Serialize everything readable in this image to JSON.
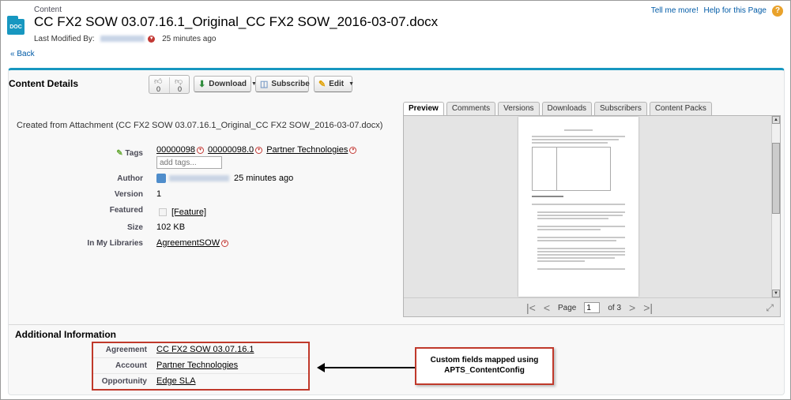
{
  "header": {
    "object_type": "Content",
    "icon_label": "DOC",
    "title": "CC FX2 SOW 03.07.16.1_Original_CC FX2 SOW_2016-03-07.docx",
    "modified_label": "Last Modified By:",
    "modified_time": "25 minutes ago",
    "back_link": "« Back"
  },
  "help": {
    "tell_me_more": "Tell me more!",
    "help_page": "Help for this Page",
    "help_icon": "?"
  },
  "details": {
    "heading": "Content Details",
    "votes": {
      "up": "0",
      "down": "0"
    },
    "buttons": {
      "download": "Download",
      "subscribe": "Subscribe",
      "edit": "Edit"
    },
    "created_from": "Created from Attachment (CC FX2 SOW 03.07.16.1_Original_CC FX2 SOW_2016-03-07.docx)",
    "fields": {
      "tags_label": "Tags",
      "tags": [
        "00000098",
        "00000098.0",
        "Partner Technologies"
      ],
      "add_tags_placeholder": "add tags...",
      "author_label": "Author",
      "author_time": "25 minutes ago",
      "version_label": "Version",
      "version_value": "1",
      "featured_label": "Featured",
      "featured_link": "[Feature]",
      "size_label": "Size",
      "size_value": "102 KB",
      "libraries_label": "In My Libraries",
      "libraries_value": "AgreementSOW"
    }
  },
  "preview": {
    "tabs": [
      "Preview",
      "Comments",
      "Versions",
      "Downloads",
      "Subscribers",
      "Content Packs"
    ],
    "active_tab": "Preview",
    "page_label": "Page",
    "current_page": "1",
    "of_label": "of 3"
  },
  "additional": {
    "heading": "Additional Information",
    "rows": [
      {
        "label": "Agreement",
        "value": "CC FX2 SOW 03.07.16.1"
      },
      {
        "label": "Account",
        "value": "Partner Technologies"
      },
      {
        "label": "Opportunity",
        "value": "Edge SLA"
      }
    ]
  },
  "annotation": {
    "line1": "Custom fields mapped using",
    "line2": "APTS_ContentConfig"
  },
  "colors": {
    "accent": "#1797c0",
    "link": "#015ba7",
    "annotation_red": "#c0392b"
  }
}
